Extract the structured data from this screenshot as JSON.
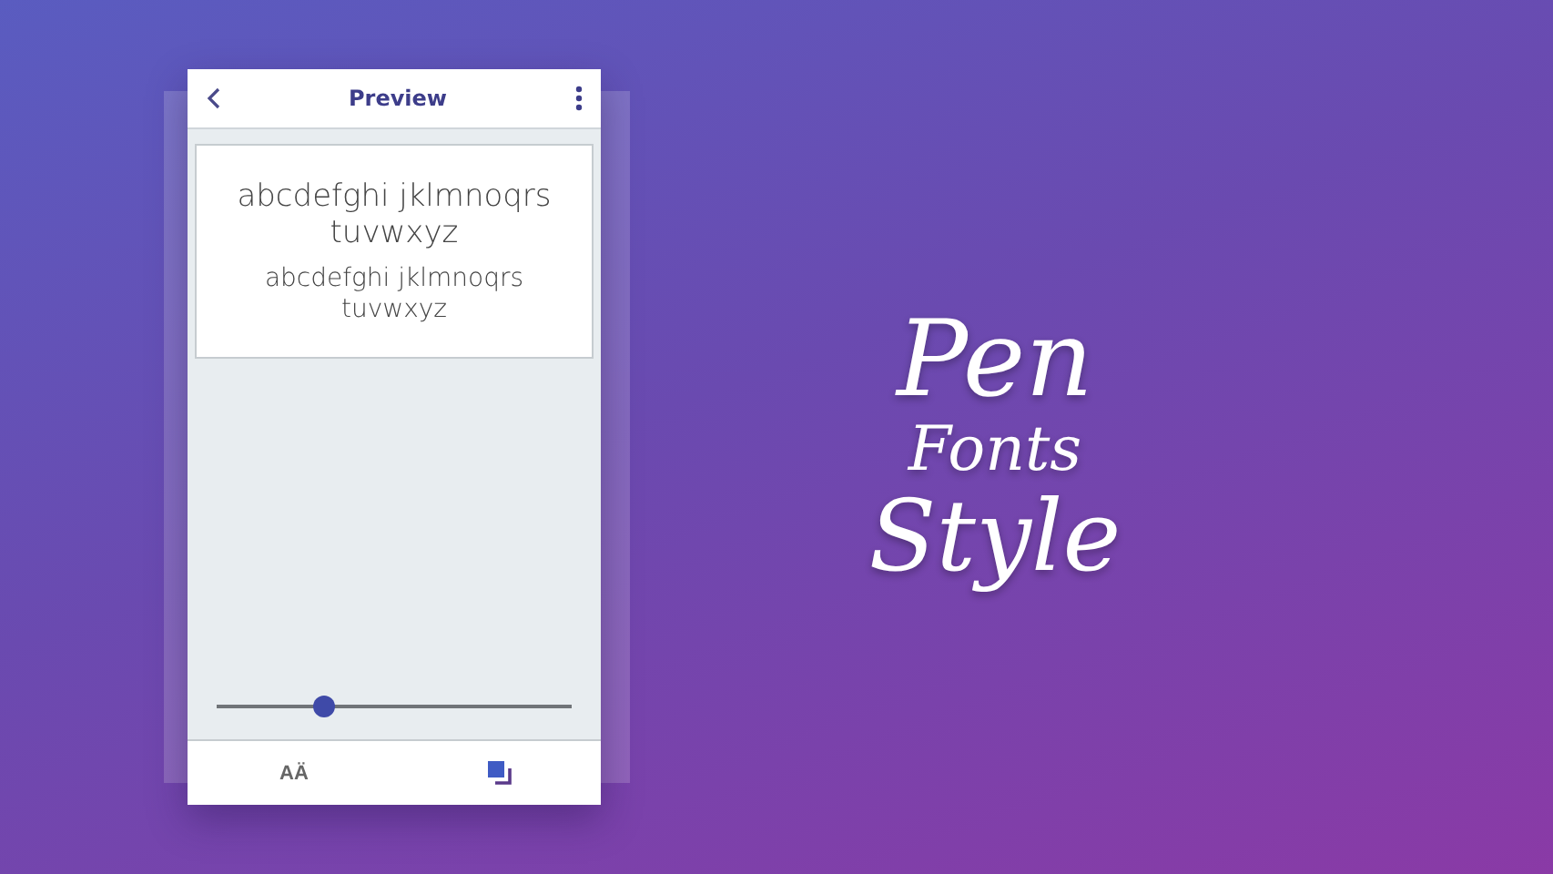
{
  "app_bar": {
    "title": "Preview"
  },
  "preview": {
    "lines": [
      "abcdefghi jklmnoqrs tuvwxyz",
      "abcdefghi jklmnoqrs tuvwxyz"
    ]
  },
  "slider": {
    "level": 0.3
  },
  "bottom_bar": {
    "text_size_label": "AÄ"
  },
  "headline": [
    "Pen",
    "Fonts",
    "Style"
  ]
}
